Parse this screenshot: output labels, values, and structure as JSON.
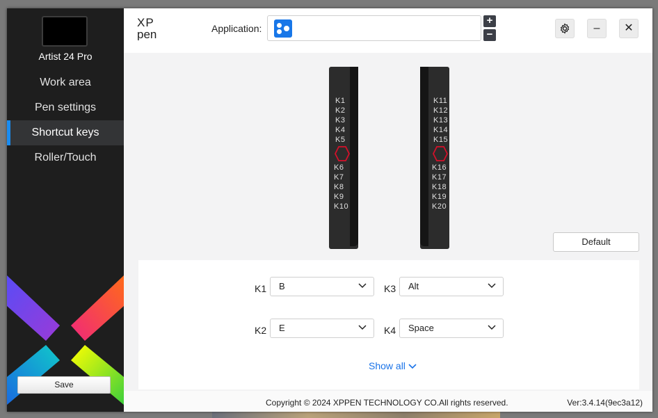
{
  "device": {
    "name": "Artist 24 Pro"
  },
  "sidebar": {
    "items": [
      {
        "label": "Work area"
      },
      {
        "label": "Pen settings"
      },
      {
        "label": "Shortcut keys",
        "active": true
      },
      {
        "label": "Roller/Touch"
      }
    ],
    "save_label": "Save"
  },
  "header": {
    "logo": "XP pen",
    "application_label": "Application:",
    "plus_icon": "plus-icon",
    "minus_icon": "minus-icon",
    "settings_icon": "gear-icon",
    "minimize_icon": "minimize-icon",
    "close_icon": "close-icon"
  },
  "left_strip": {
    "keys_top": [
      "K1",
      "K2",
      "K3",
      "K4",
      "K5"
    ],
    "keys_bottom": [
      "K6",
      "K7",
      "K8",
      "K9",
      "K10"
    ]
  },
  "right_strip": {
    "keys_top": [
      "K11",
      "K12",
      "K13",
      "K14",
      "K15"
    ],
    "keys_bottom": [
      "K16",
      "K17",
      "K18",
      "K19",
      "K20"
    ]
  },
  "default_label": "Default",
  "shortcuts": [
    {
      "key": "K1",
      "value": "B"
    },
    {
      "key": "K2",
      "value": "E"
    },
    {
      "key": "K3",
      "value": "Alt"
    },
    {
      "key": "K4",
      "value": "Space"
    }
  ],
  "show_all": "Show all",
  "footer": {
    "copyright": "Copyright © 2024  XPPEN TECHNOLOGY CO.All rights reserved.",
    "version": "Ver:3.4.14(9ec3a12)"
  },
  "colors": {
    "accent": "#1a8cf0",
    "app_icon": "#1877e8",
    "link": "#1a73e8"
  }
}
